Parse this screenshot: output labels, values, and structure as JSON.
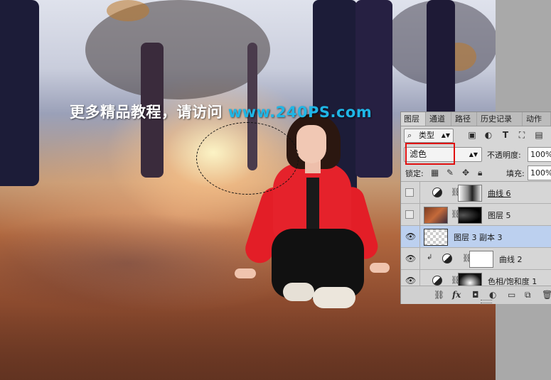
{
  "watermark": {
    "chinese_text": "更多精品教程，请访问",
    "url": "www.240PS.com"
  },
  "panel": {
    "tabs": [
      {
        "label": "图层",
        "active": true
      },
      {
        "label": "通道",
        "active": false
      },
      {
        "label": "路径",
        "active": false
      },
      {
        "label": "历史记录",
        "active": false
      },
      {
        "label": "动作",
        "active": false
      }
    ],
    "filter": {
      "label": "类型",
      "icons": [
        "search-icon",
        "image-filter-icon",
        "adjustment-filter-icon",
        "type-filter-icon",
        "shape-filter-icon",
        "smart-object-filter-icon"
      ]
    },
    "blend_mode": "滤色",
    "opacity_label": "不透明度:",
    "opacity_value": "100%",
    "lock_label": "锁定:",
    "fill_label": "填充:",
    "fill_value": "100%",
    "layers": [
      {
        "name": "曲线 6",
        "visible": false,
        "type": "adjustment",
        "selected": false
      },
      {
        "name": "图层 5",
        "visible": false,
        "type": "pixel-with-mask",
        "selected": false
      },
      {
        "name": "图层 3 副本 3",
        "visible": true,
        "type": "smart-object",
        "selected": true
      },
      {
        "name": "曲线 2",
        "visible": true,
        "type": "adjustment-clipped",
        "selected": false
      },
      {
        "name": "色相/饱和度 1",
        "visible": true,
        "type": "adjustment",
        "selected": false
      }
    ],
    "bottom_icons": [
      "link-icon",
      "fx-icon",
      "mask-icon",
      "adjustment-icon",
      "group-folder-icon",
      "new-layer-icon",
      "trash-icon"
    ],
    "fx_label": "fx"
  },
  "colors": {
    "watermark_url": "#1fb6e6",
    "selected_layer": "#bcd0ef",
    "highlight_box": "#e01010"
  }
}
